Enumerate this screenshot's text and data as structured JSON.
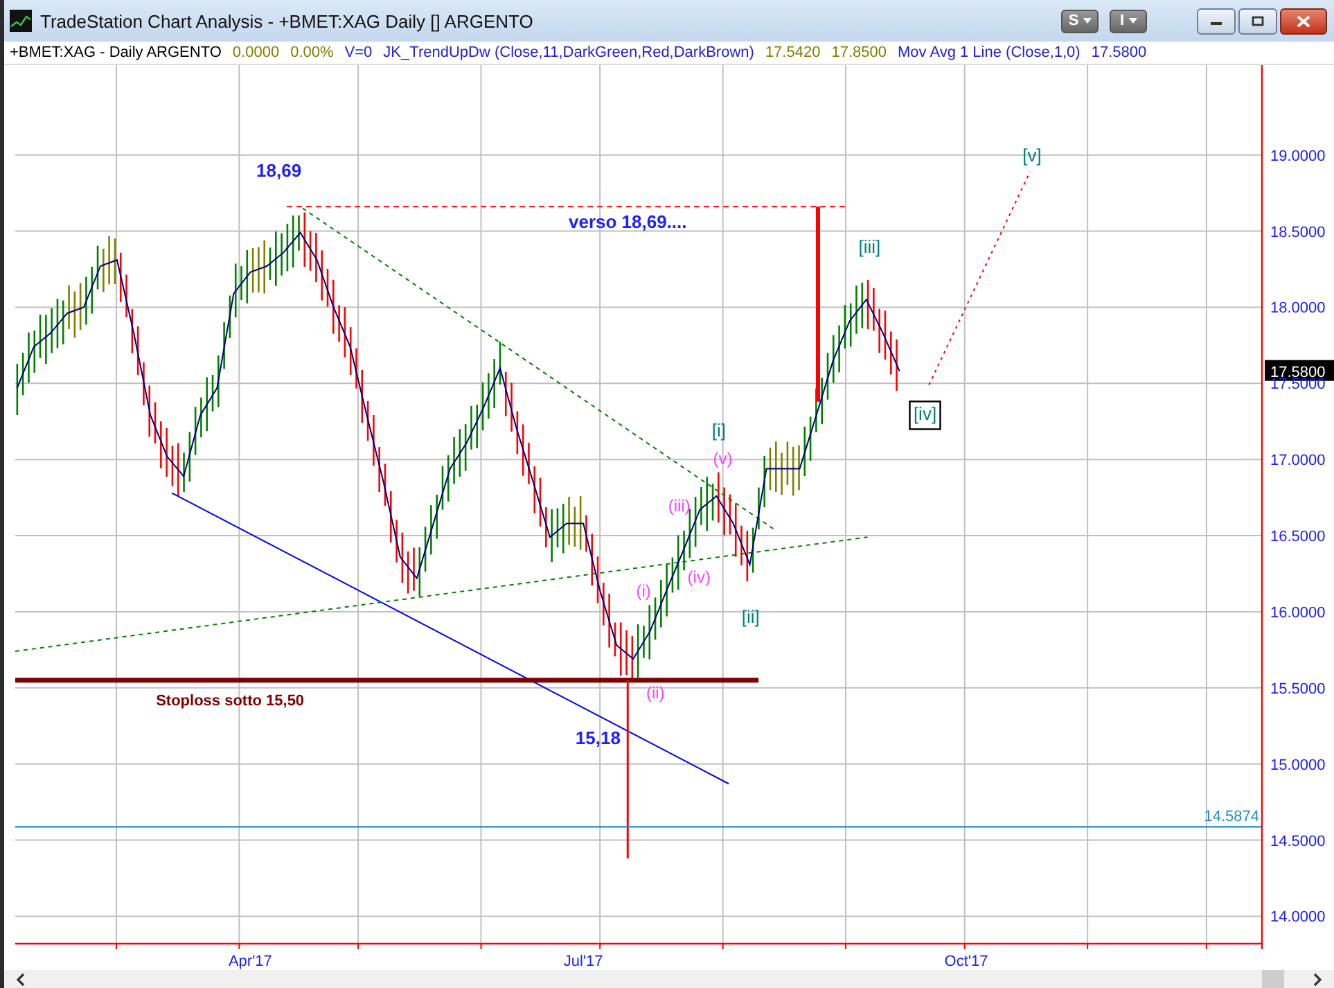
{
  "window": {
    "title": "TradeStation Chart Analysis - +BMET:XAG Daily [] ARGENTO",
    "toolbar_buttons": [
      "S",
      "I"
    ]
  },
  "legend": [
    {
      "kind": "symbol",
      "text": "+BMET:XAG - Daily  ARGENTO"
    },
    {
      "kind": "value",
      "text": "0.0000"
    },
    {
      "kind": "value",
      "text": "0.00%"
    },
    {
      "kind": "indicator",
      "text": "V=0"
    },
    {
      "kind": "indicator",
      "text": "JK_TrendUpDw (Close,11,DarkGreen,Red,DarkBrown)"
    },
    {
      "kind": "value",
      "text": "17.5420"
    },
    {
      "kind": "value",
      "text": "17.8500"
    },
    {
      "kind": "indicator",
      "text": "Mov Avg 1 Line (Close,1,0)"
    },
    {
      "kind": "indicator",
      "text": "17.5800"
    }
  ],
  "chart": {
    "last_price": "17.5800",
    "chart_data": {
      "type": "line",
      "grid": true,
      "ylim": [
        13.82,
        19.59
      ],
      "categories": [
        null,
        null,
        null,
        null,
        null,
        null,
        null,
        null,
        null,
        null,
        null,
        null,
        null,
        null,
        "Apr'17",
        null,
        null,
        null,
        null,
        null,
        null,
        null,
        null,
        null,
        null,
        null,
        null,
        null,
        null,
        null,
        null,
        null,
        null,
        null,
        "Jul'17",
        null,
        null,
        null,
        null,
        null,
        null,
        null,
        null,
        null,
        null,
        null,
        null,
        null,
        null,
        null,
        null,
        null,
        null,
        null,
        null,
        null,
        null,
        "Oct'17",
        null,
        null,
        null,
        null,
        null,
        null,
        null,
        null,
        null,
        null,
        null,
        null,
        null,
        null,
        null,
        null,
        null,
        null
      ],
      "yticks": [
        {
          "value": 14.0,
          "label": "14.0000"
        },
        {
          "value": 14.5,
          "label": "14.5000"
        },
        {
          "value": 15.0,
          "label": "15.0000"
        },
        {
          "value": 15.5,
          "label": "15.5000"
        },
        {
          "value": 16.0,
          "label": "16.0000"
        },
        {
          "value": 16.5,
          "label": "16.5000"
        },
        {
          "value": 17.0,
          "label": "17.0000"
        },
        {
          "value": 17.5,
          "label": "17.5000"
        },
        {
          "value": 18.0,
          "label": "18.0000"
        },
        {
          "value": 18.5,
          "label": "18.5000"
        },
        {
          "value": 19.0,
          "label": "19.0000"
        }
      ],
      "series": [
        {
          "color": "#000080",
          "values": [
            17.47,
            17.74,
            17.83,
            17.96,
            18.0,
            18.27,
            18.31,
            17.83,
            17.29,
            17.02,
            16.89,
            17.29,
            17.47,
            18.09,
            18.23,
            18.27,
            18.36,
            18.49,
            18.31,
            18.0,
            17.74,
            17.29,
            16.85,
            16.36,
            16.22,
            16.58,
            16.94,
            17.11,
            17.34,
            17.6,
            17.2,
            16.85,
            16.49,
            16.58,
            16.58,
            16.14,
            15.78,
            15.69,
            15.87,
            16.14,
            16.4,
            16.67,
            16.76,
            16.58,
            16.31,
            16.94,
            16.94,
            16.94,
            17.29,
            17.65,
            17.91,
            18.05,
            17.83,
            17.58,
            null,
            null,
            null,
            null,
            null,
            null,
            null,
            null,
            null,
            null,
            null,
            null,
            null,
            null,
            null,
            null,
            null,
            null,
            null,
            null,
            null,
            null
          ]
        }
      ],
      "ref_lines": [
        {
          "axis": "y",
          "value": 14.5874,
          "label": "14.5874"
        }
      ],
      "annotations": [
        "18,69",
        "verso 18,69....",
        "Stoploss  sotto 15,50",
        "15,18",
        "(i)",
        "(ii)",
        "(iii)",
        "(iv)",
        "(v)",
        "[i]",
        "[ii]",
        "[iii]",
        "[iv]",
        "[v]"
      ]
    }
  }
}
